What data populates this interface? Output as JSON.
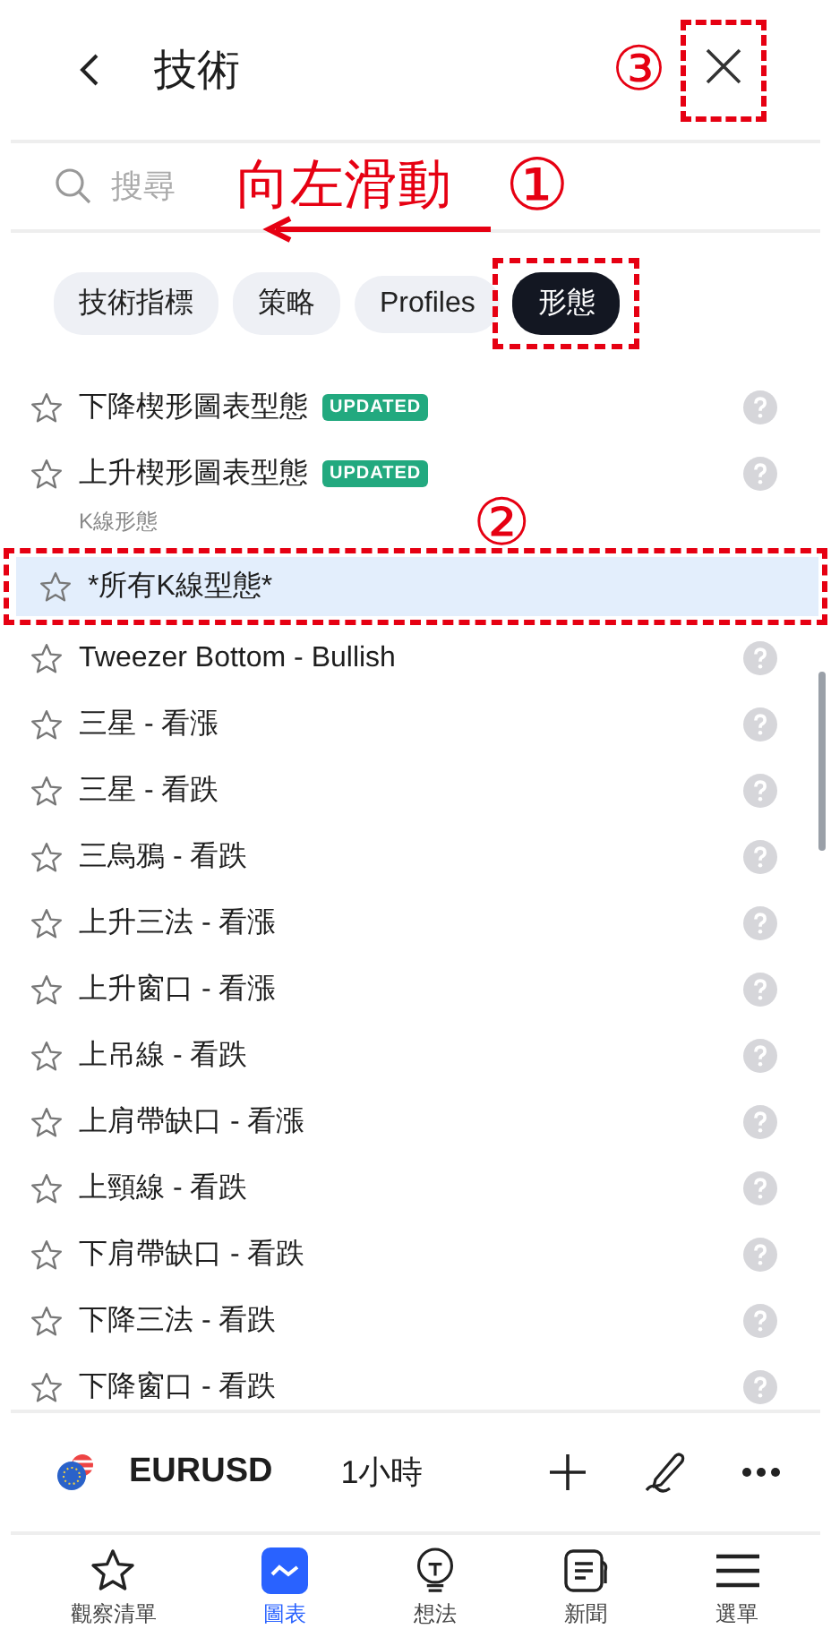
{
  "header": {
    "title": "技術",
    "marker": "③",
    "close_framed": true
  },
  "search": {
    "placeholder": "搜尋",
    "hint": "向左滑動",
    "marker": "①"
  },
  "chips": [
    {
      "label": "技術指標",
      "selected": false,
      "framed": false
    },
    {
      "label": "策略",
      "selected": false,
      "framed": false
    },
    {
      "label": "Profiles",
      "selected": false,
      "framed": false
    },
    {
      "label": "形態",
      "selected": true,
      "framed": true
    }
  ],
  "list": [
    {
      "kind": "item",
      "label": "下降楔形圖表型態",
      "badge": "UPDATED",
      "selected": false
    },
    {
      "kind": "item",
      "label": "上升楔形圖表型態",
      "badge": "UPDATED",
      "selected": false
    },
    {
      "kind": "section",
      "label": "K線形態",
      "marker": "②"
    },
    {
      "kind": "item",
      "label": "*所有K線型態*",
      "selected": true,
      "framed": true
    },
    {
      "kind": "item",
      "label": "Tweezer Bottom - Bullish",
      "selected": false
    },
    {
      "kind": "item",
      "label": "三星 - 看漲",
      "selected": false
    },
    {
      "kind": "item",
      "label": "三星 - 看跌",
      "selected": false
    },
    {
      "kind": "item",
      "label": "三烏鴉 - 看跌",
      "selected": false
    },
    {
      "kind": "item",
      "label": "上升三法 - 看漲",
      "selected": false
    },
    {
      "kind": "item",
      "label": "上升窗口 - 看漲",
      "selected": false
    },
    {
      "kind": "item",
      "label": "上吊線 - 看跌",
      "selected": false
    },
    {
      "kind": "item",
      "label": "上肩帶缺口 - 看漲",
      "selected": false
    },
    {
      "kind": "item",
      "label": "上頸線 - 看跌",
      "selected": false
    },
    {
      "kind": "item",
      "label": "下肩帶缺口 - 看跌",
      "selected": false
    },
    {
      "kind": "item",
      "label": "下降三法 - 看跌",
      "selected": false
    },
    {
      "kind": "item",
      "label": "下降窗口 - 看跌",
      "selected": false
    }
  ],
  "toolbar": {
    "symbol": "EURUSD",
    "interval": "1小時"
  },
  "nav": [
    {
      "label": "觀察清單",
      "kind": "star",
      "selected": false
    },
    {
      "label": "圖表",
      "kind": "chart",
      "selected": true
    },
    {
      "label": "想法",
      "kind": "bulb",
      "selected": false
    },
    {
      "label": "新聞",
      "kind": "news",
      "selected": false
    },
    {
      "label": "選單",
      "kind": "menu",
      "selected": false
    }
  ]
}
